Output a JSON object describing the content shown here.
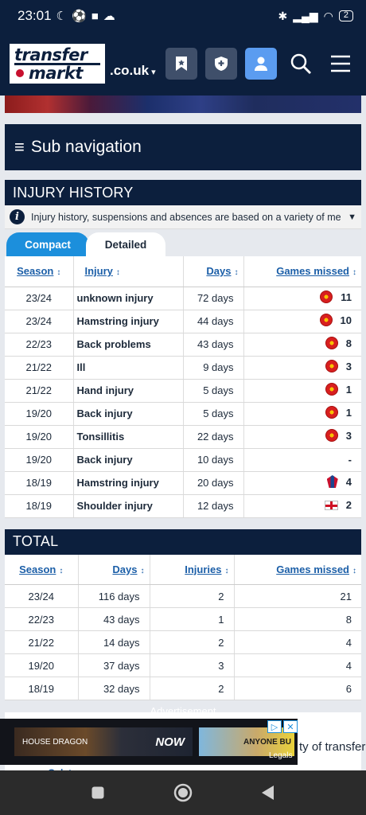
{
  "status_bar": {
    "time": "23:01",
    "icons": [
      "moon-icon",
      "app-icon",
      "square-icon",
      "cloud-icon"
    ],
    "battery": "2"
  },
  "header": {
    "logo_line1": "transfer",
    "logo_line2": "markt",
    "domain": ".co.uk",
    "icons": [
      "bookmark-icon",
      "shield-icon",
      "user-icon",
      "search-icon",
      "menu-icon"
    ]
  },
  "subnav": {
    "label": "Sub navigation"
  },
  "injury_history": {
    "title": "INJURY HISTORY",
    "info": "Injury history, suspensions and absences are based on a variety of media r...",
    "tabs": [
      "Compact",
      "Detailed"
    ],
    "headers": [
      "Season",
      "Injury",
      "Days",
      "Games missed"
    ],
    "rows": [
      {
        "season": "23/24",
        "injury": "unknown injury",
        "days": "72 days",
        "club": "mu",
        "games": "11"
      },
      {
        "season": "23/24",
        "injury": "Hamstring injury",
        "days": "44 days",
        "club": "mu",
        "games": "10"
      },
      {
        "season": "22/23",
        "injury": "Back problems",
        "days": "43 days",
        "club": "mu",
        "games": "8"
      },
      {
        "season": "21/22",
        "injury": "Ill",
        "days": "9 days",
        "club": "mu",
        "games": "3"
      },
      {
        "season": "21/22",
        "injury": "Hand injury",
        "days": "5 days",
        "club": "mu",
        "games": "1"
      },
      {
        "season": "19/20",
        "injury": "Back injury",
        "days": "5 days",
        "club": "mu",
        "games": "1"
      },
      {
        "season": "19/20",
        "injury": "Tonsillitis",
        "days": "22 days",
        "club": "mu",
        "games": "3"
      },
      {
        "season": "19/20",
        "injury": "Back injury",
        "days": "10 days",
        "club": "",
        "games": "-"
      },
      {
        "season": "18/19",
        "injury": "Hamstring injury",
        "days": "20 days",
        "club": "cp",
        "games": "4"
      },
      {
        "season": "18/19",
        "injury": "Shoulder injury",
        "days": "12 days",
        "club": "en",
        "games": "2"
      }
    ]
  },
  "total": {
    "title": "TOTAL",
    "headers": [
      "Season",
      "Days",
      "Injuries",
      "Games missed"
    ],
    "rows": [
      {
        "season": "23/24",
        "days": "116 days",
        "injuries": "2",
        "games": "21"
      },
      {
        "season": "22/23",
        "days": "43 days",
        "injuries": "1",
        "games": "8"
      },
      {
        "season": "21/22",
        "days": "14 days",
        "injuries": "2",
        "games": "4"
      },
      {
        "season": "19/20",
        "days": "37 days",
        "injuries": "3",
        "games": "4"
      },
      {
        "season": "18/19",
        "days": "32 days",
        "injuries": "2",
        "games": "6"
      }
    ]
  },
  "ad": {
    "label": "Advertisement",
    "now_text": "NOW",
    "house_text": "HOUSE DRAGON",
    "anyone_text": "ANYONE BU",
    "legals": "Legals"
  },
  "peek": {
    "text": "ty of transfer",
    "club": "Galatasaray"
  }
}
